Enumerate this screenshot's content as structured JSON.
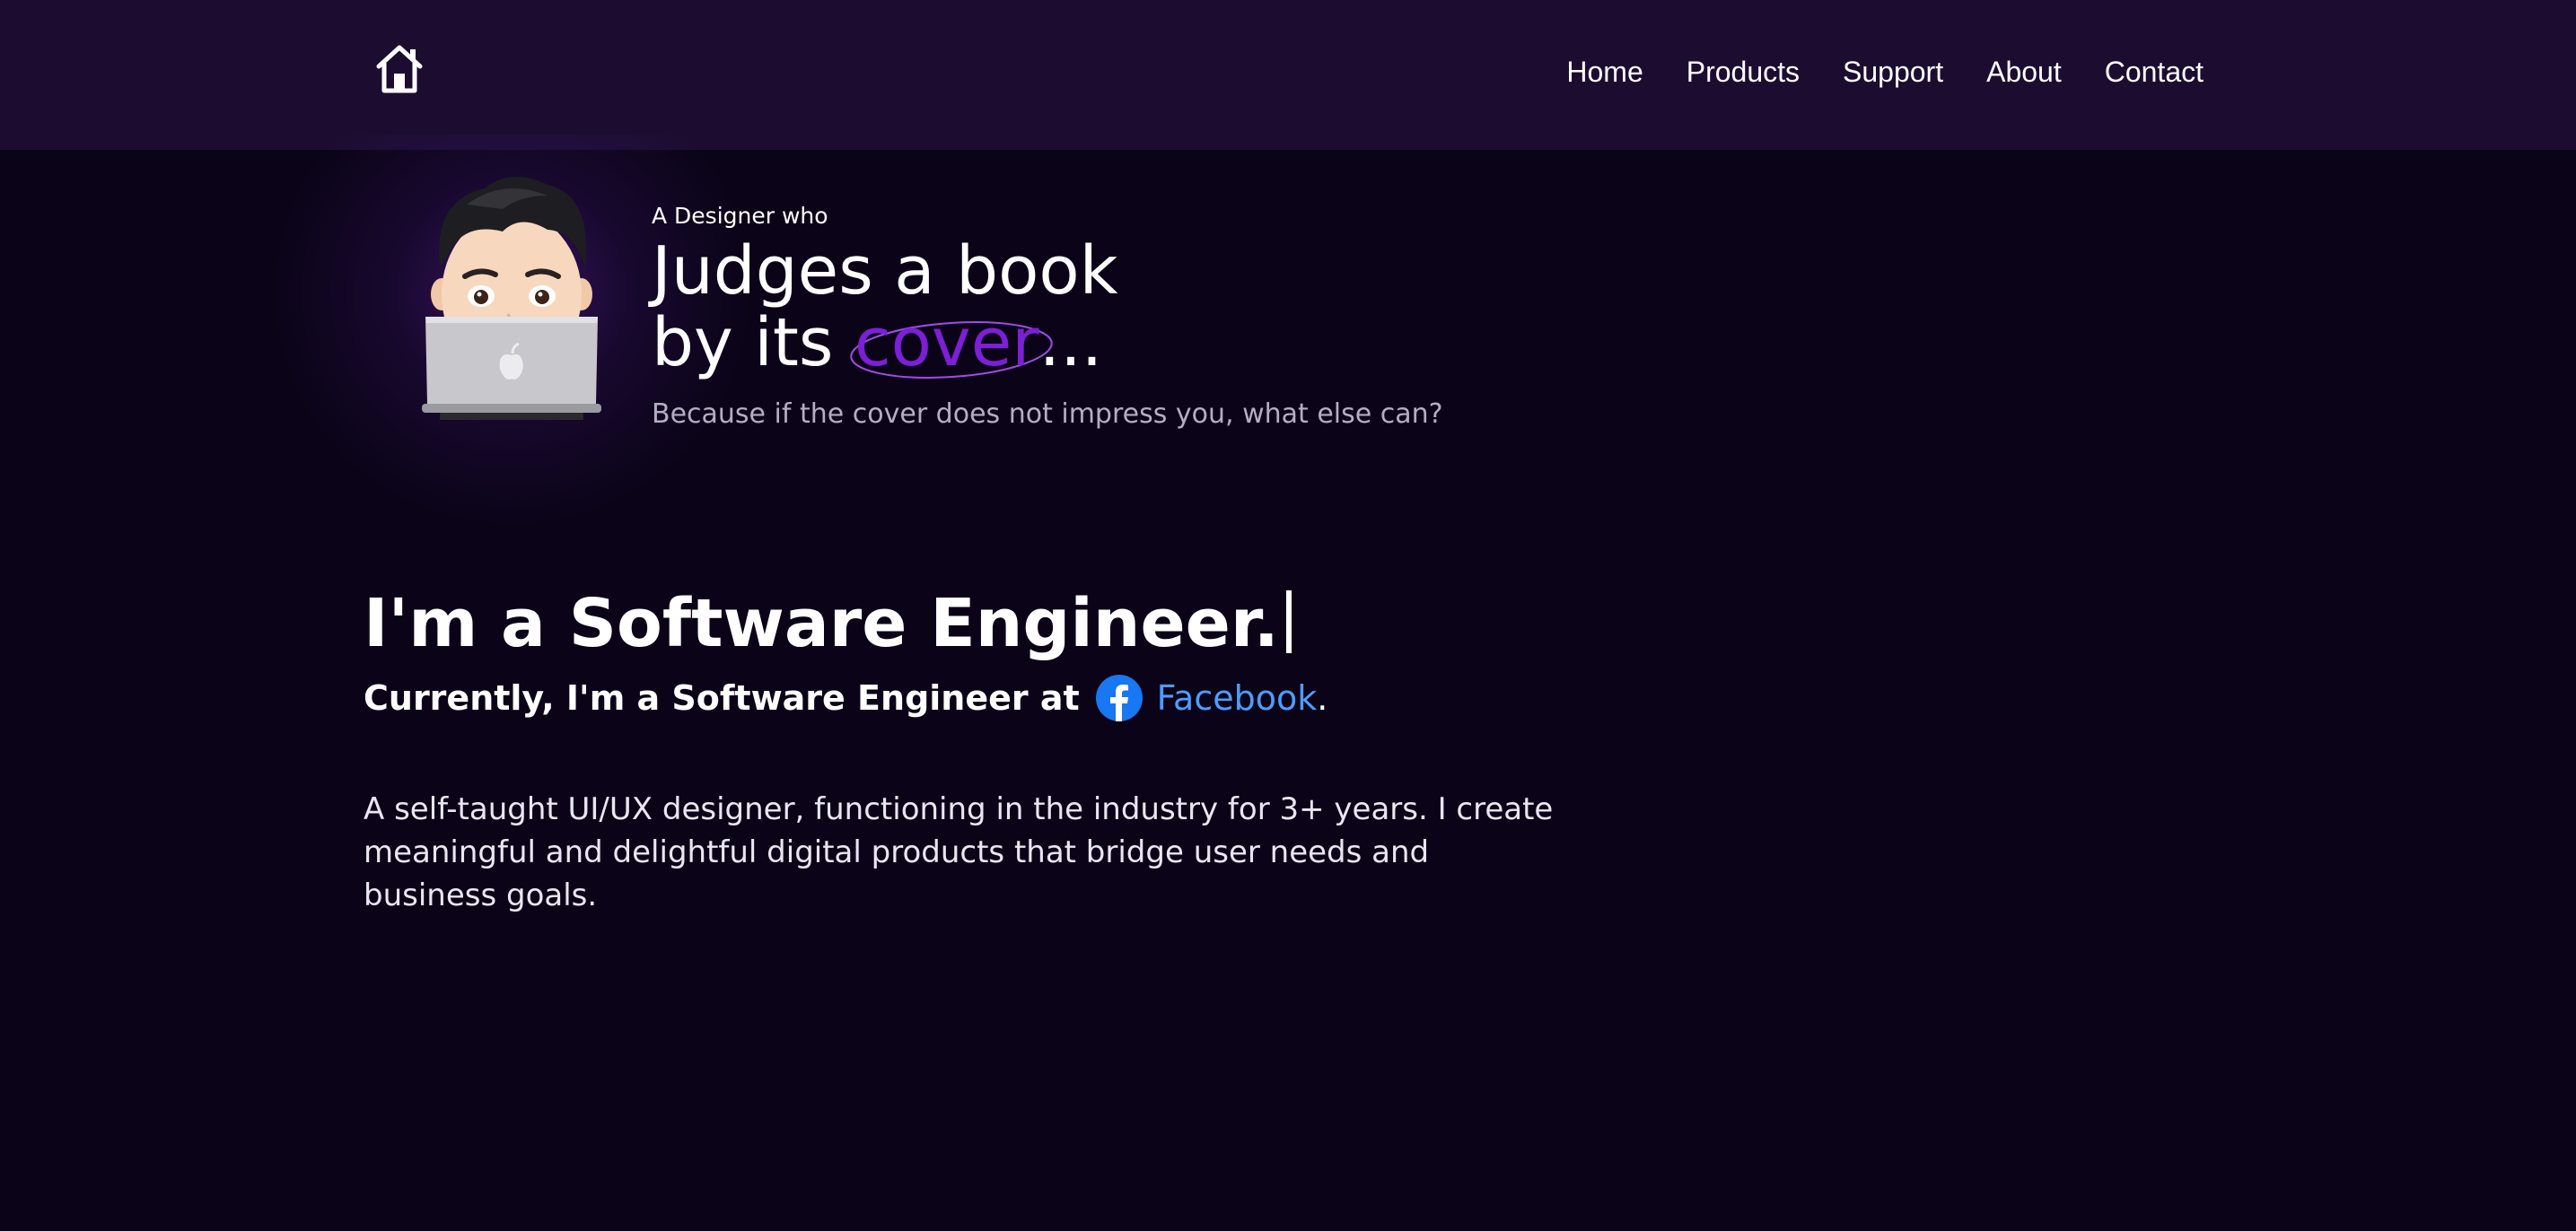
{
  "header": {
    "logo_icon": "home-icon",
    "nav": [
      {
        "label": "Home"
      },
      {
        "label": "Products"
      },
      {
        "label": "Support"
      },
      {
        "label": "About"
      },
      {
        "label": "Contact"
      }
    ]
  },
  "hero": {
    "eyebrow": "A Designer who",
    "title_line1": "Judges a book",
    "title_line2_prefix": "by its ",
    "title_highlight": "cover",
    "title_line2_suffix": "...",
    "subtitle": "Because if the cover does not impress you, what else can?",
    "avatar_icon": "memoji-laptop-avatar",
    "highlight_color": "#7c1fd6"
  },
  "role": {
    "headline": "I'm a Software Engineer.",
    "current_prefix": "Currently, I'm a Software Engineer at",
    "company_icon": "facebook-icon",
    "company_name": "Facebook",
    "current_suffix": ".",
    "bio": "A self-taught UI/UX designer, functioning in the industry for 3+ years. I create meaningful and delightful digital products that bridge user needs and business goals."
  },
  "colors": {
    "background": "#0b0418",
    "header": "#1c0d30",
    "link": "#4c9dff",
    "facebook": "#1877f2"
  }
}
